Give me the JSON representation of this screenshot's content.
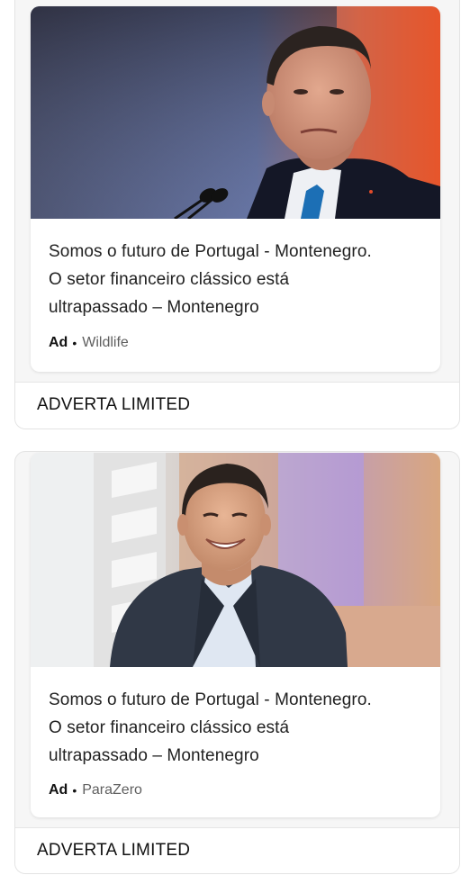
{
  "ads": [
    {
      "image_icon": "politician-portrait-photo",
      "headline_line1": "Somos o futuro de Portugal - Montenegro.",
      "headline_line2": "O setor financeiro clássico está",
      "headline_line3": "ultrapassado – Montenegro",
      "badge": "Ad",
      "dot": "•",
      "source": "Wildlife",
      "advertiser": "ADVERTA LIMITED"
    },
    {
      "image_icon": "smiling-man-photo",
      "headline_line1": "Somos o futuro de Portugal - Montenegro.",
      "headline_line2": "O setor financeiro clássico está",
      "headline_line3": "ultrapassado – Montenegro",
      "badge": "Ad",
      "dot": "•",
      "source": "ParaZero",
      "advertiser": "ADVERTA LIMITED"
    }
  ]
}
